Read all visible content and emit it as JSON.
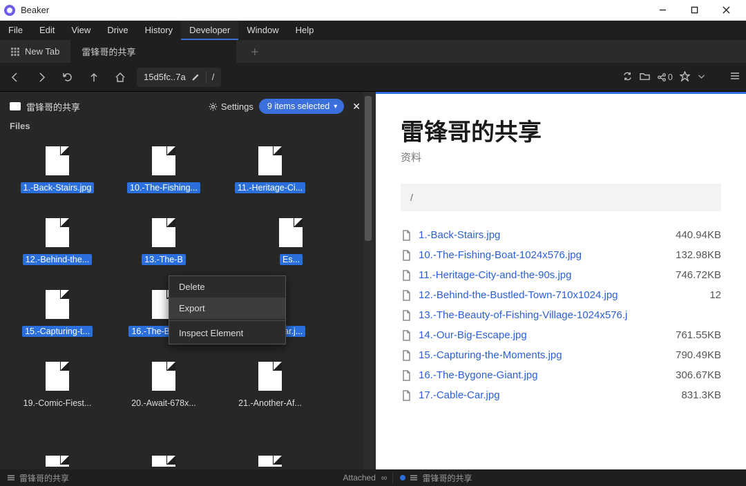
{
  "app": {
    "title": "Beaker"
  },
  "menu": [
    "File",
    "Edit",
    "View",
    "Drive",
    "History",
    "Developer",
    "Window",
    "Help"
  ],
  "menu_active_index": 5,
  "tabs": {
    "new_tab": "New Tab",
    "active": "雷锋哥的共享"
  },
  "toolbar": {
    "addr_hash": "15d5fc..7a",
    "addr_path": "/",
    "share_count": "0"
  },
  "left": {
    "drive_name": "雷锋哥的共享",
    "settings_label": "Settings",
    "selection_pill": "9 items selected",
    "files_label": "Files",
    "grid": [
      {
        "name": "1.-Back-Stairs.jpg",
        "sel": true
      },
      {
        "name": "10.-The-Fishing...",
        "sel": true
      },
      {
        "name": "11.-Heritage-Ci...",
        "sel": true
      },
      {
        "name": "12.-Behind-the...",
        "sel": true
      },
      {
        "name": "13.-The-B",
        "sel": true
      },
      {
        "name": "Es...",
        "sel": true,
        "frag": true
      },
      {
        "name": "15.-Capturing-t...",
        "sel": true
      },
      {
        "name": "16.-The-Bygon...",
        "sel": true
      },
      {
        "name": "17.-Cable-Car.j...",
        "sel": true
      },
      {
        "name": "19.-Comic-Fiest...",
        "sel": false
      },
      {
        "name": "20.-Await-678x...",
        "sel": false
      },
      {
        "name": "21.-Another-Af...",
        "sel": false
      }
    ]
  },
  "context_menu": {
    "items": [
      "Delete",
      "Export",
      "Inspect Element"
    ],
    "hover_index": 1
  },
  "right": {
    "title": "雷锋哥的共享",
    "subtitle": "资料",
    "path": "/",
    "files": [
      {
        "name": "1.-Back-Stairs.jpg",
        "size": "440.94KB"
      },
      {
        "name": "10.-The-Fishing-Boat-1024x576.jpg",
        "size": "132.98KB"
      },
      {
        "name": "11.-Heritage-City-and-the-90s.jpg",
        "size": "746.72KB"
      },
      {
        "name": "12.-Behind-the-Bustled-Town-710x1024.jpg",
        "size": "12"
      },
      {
        "name": "13.-The-Beauty-of-Fishing-Village-1024x576.j",
        "size": ""
      },
      {
        "name": "14.-Our-Big-Escape.jpg",
        "size": "761.55KB"
      },
      {
        "name": "15.-Capturing-the-Moments.jpg",
        "size": "790.49KB"
      },
      {
        "name": "16.-The-Bygone-Giant.jpg",
        "size": "306.67KB"
      },
      {
        "name": "17.-Cable-Car.jpg",
        "size": "831.3KB"
      }
    ]
  },
  "status": {
    "left": "雷锋哥的共享",
    "attached": "Attached",
    "infinity": "∞",
    "right": "雷锋哥的共享"
  }
}
